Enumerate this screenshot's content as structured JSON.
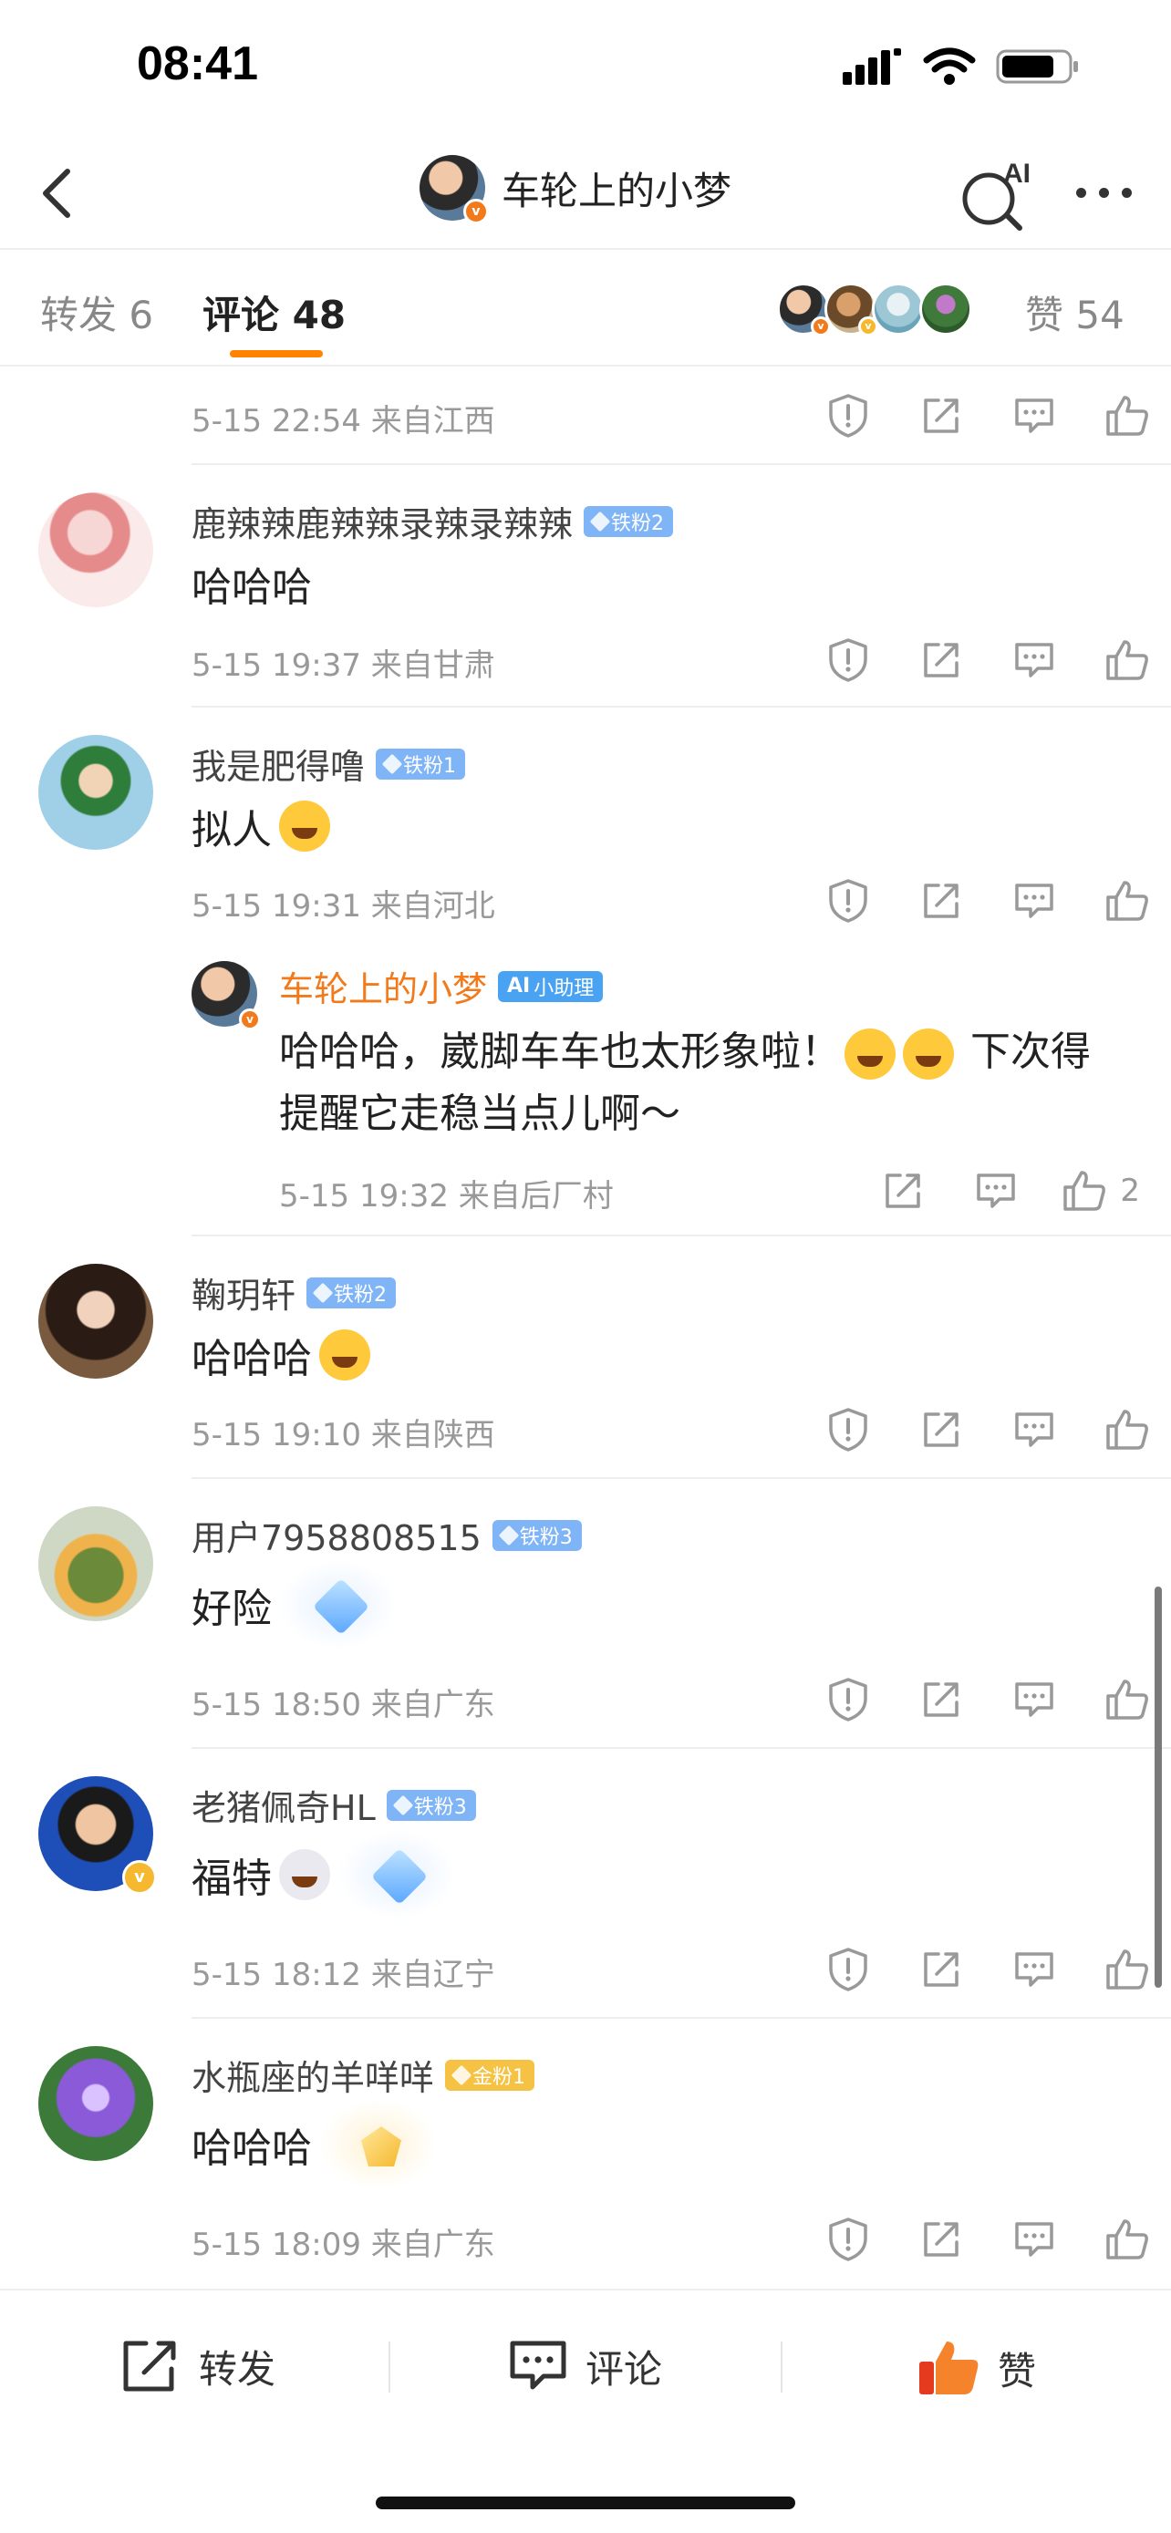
{
  "status_bar": {
    "time": "08:41"
  },
  "header": {
    "title": "车轮上的小梦",
    "ai_label": "AI"
  },
  "tabs": {
    "repost": "转发 6",
    "comment": "评论 48",
    "like": "赞 54"
  },
  "comments": [
    {
      "meta": "5-15 22:54  来自江西"
    },
    {
      "name": "鹿辣辣鹿辣辣录辣录辣辣",
      "badge": "铁粉2",
      "text": "哈哈哈",
      "meta": "5-15 19:37  来自甘肃"
    },
    {
      "name": "我是肥得噜",
      "badge": "铁粉1",
      "text": "拟人",
      "meta": "5-15 19:31  来自河北",
      "reply": {
        "name": "车轮上的小梦",
        "badge": "小助理",
        "text_a": "哈哈哈，崴脚车车也太形象啦！",
        "text_b": "下次得提醒它走稳当点儿啊～",
        "meta": "5-15 19:32  来自后厂村",
        "likes": "2"
      }
    },
    {
      "name": "鞠玥轩",
      "badge": "铁粉2",
      "text": "哈哈哈",
      "meta": "5-15 19:10  来自陕西"
    },
    {
      "name": "用户7958808515",
      "badge": "铁粉3",
      "text": "好险",
      "meta": "5-15 18:50  来自广东"
    },
    {
      "name": "老猪佩奇HL",
      "badge": "铁粉3",
      "text": "福特",
      "meta": "5-15 18:12  来自辽宁"
    },
    {
      "name": "水瓶座的羊咩咩",
      "badge": "金粉1",
      "text": "哈哈哈",
      "meta": "5-15 18:09  来自广东"
    }
  ],
  "bottom_bar": {
    "repost": "转发",
    "comment": "评论",
    "like": "赞"
  },
  "colors": {
    "accent": "#ff8200",
    "badge_blue": "#7fb4f7",
    "badge_gold": "#f6c244",
    "meta_gray": "#999999"
  }
}
